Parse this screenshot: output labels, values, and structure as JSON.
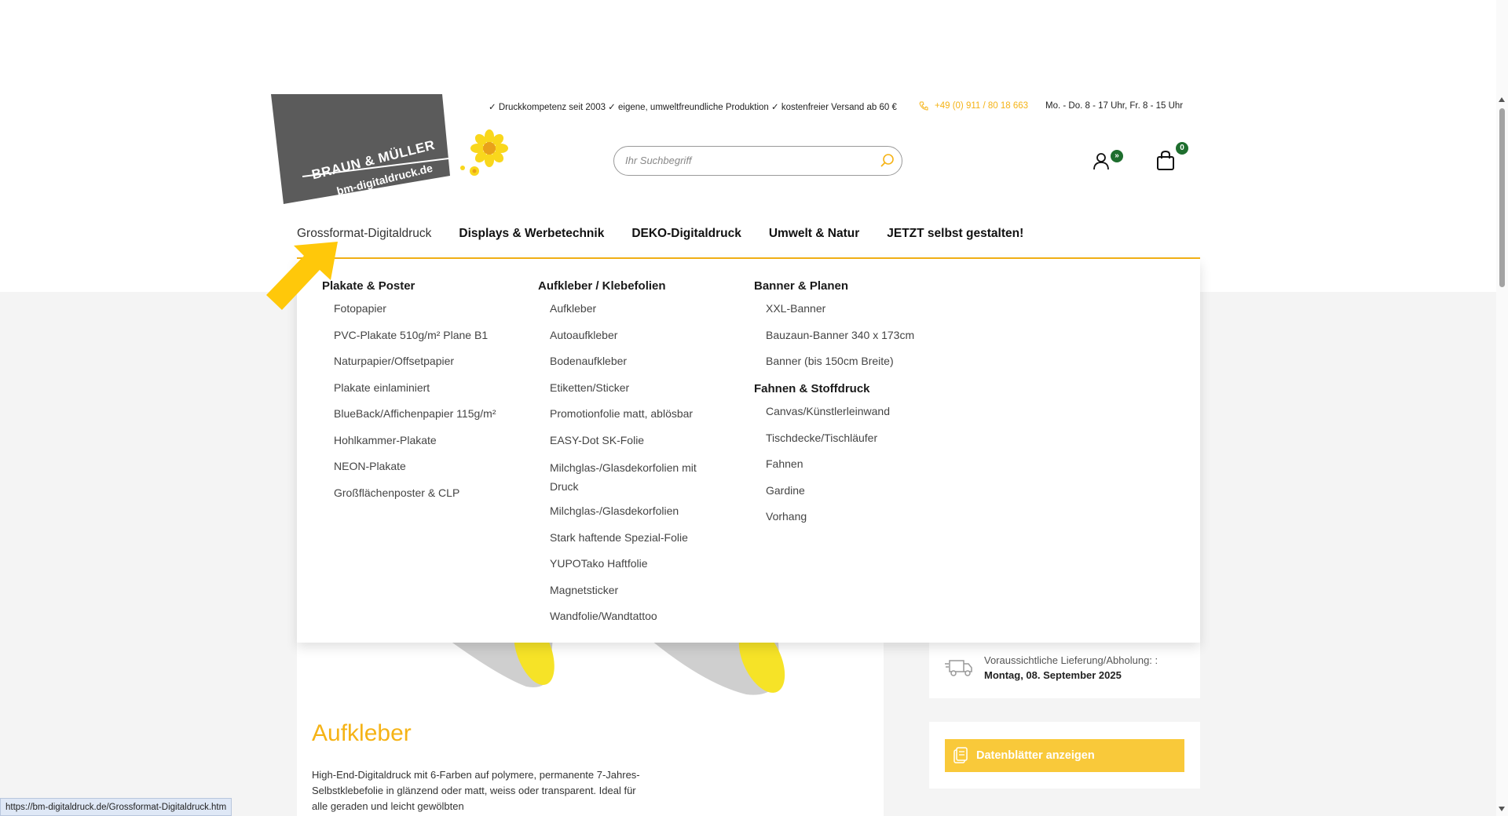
{
  "header": {
    "logo_name": "BRAUN & MÜLLER",
    "logo_domain": "bm-digitaldruck.de",
    "usp_text": "✓ Druckkompetenz seit 2003 ✓ eigene, umweltfreundliche Produktion ✓ kostenfreier Versand ab 60 €",
    "phone": "+49 (0) 911 / 80 18 663",
    "hours": "Mo. - Do. 8 - 17 Uhr, Fr. 8 - 15 Uhr",
    "search_placeholder": "Ihr Suchbegriff",
    "account_badge": "»",
    "cart_count": "0"
  },
  "nav": {
    "items": [
      "Grossformat-Digitaldruck",
      "Displays & Werbetechnik",
      "DEKO-Digitaldruck",
      "Umwelt & Natur",
      "JETZT selbst gestalten!"
    ]
  },
  "mega_menu": {
    "col1": {
      "heading": "Plakate & Poster",
      "items": [
        "Fotopapier",
        "PVC-Plakate 510g/m² Plane B1",
        "Naturpapier/Offsetpapier",
        "Plakate einlaminiert",
        "BlueBack/Affichenpapier 115g/m²",
        "Hohlkammer-Plakate",
        "NEON-Plakate",
        "Großflächenposter & CLP"
      ]
    },
    "col2": {
      "heading": "Aufkleber / Klebefolien",
      "items": [
        "Aufkleber",
        "Autoaufkleber",
        "Bodenaufkleber",
        "Etiketten/Sticker",
        "Promotionfolie matt, ablösbar",
        "EASY-Dot SK-Folie",
        "Milchglas-/Glasdekorfolien mit Druck",
        "Milchglas-/Glasdekorfolien",
        "Stark haftende Spezial-Folie",
        "YUPOTako Haftfolie",
        "Magnetsticker",
        "Wandfolie/Wandtattoo"
      ]
    },
    "col3": {
      "heading": "Banner & Planen",
      "items": [
        "XXL-Banner",
        "Bauzaun-Banner 340 x 173cm",
        "Banner (bis 150cm Breite)"
      ],
      "heading2": "Fahnen & Stoffdruck",
      "items2": [
        "Canvas/Künstlerleinwand",
        "Tischdecke/Tischläufer",
        "Fahnen",
        "Gardine",
        "Vorhang"
      ]
    }
  },
  "product": {
    "title": "Aufkleber",
    "description": "High-End-Digitaldruck mit 6-Farben auf polymere, permanente 7-Jahres-Selbstklebefolie in glänzend oder matt, weiss oder transparent. Ideal für alle geraden und leicht gewölbten"
  },
  "sidebar": {
    "delivery_label": "Voraussichtliche Lieferung/Abholung: :",
    "delivery_date": "Montag, 08. September 2025",
    "datasheet_button": "Datenblätter anzeigen"
  },
  "status_url": "https://bm-digitaldruck.de/Grossformat-Digitaldruck.htm",
  "colors": {
    "accent": "#f5b316",
    "badge": "#1e6e2e",
    "logo_bg": "#5b5b5b"
  }
}
